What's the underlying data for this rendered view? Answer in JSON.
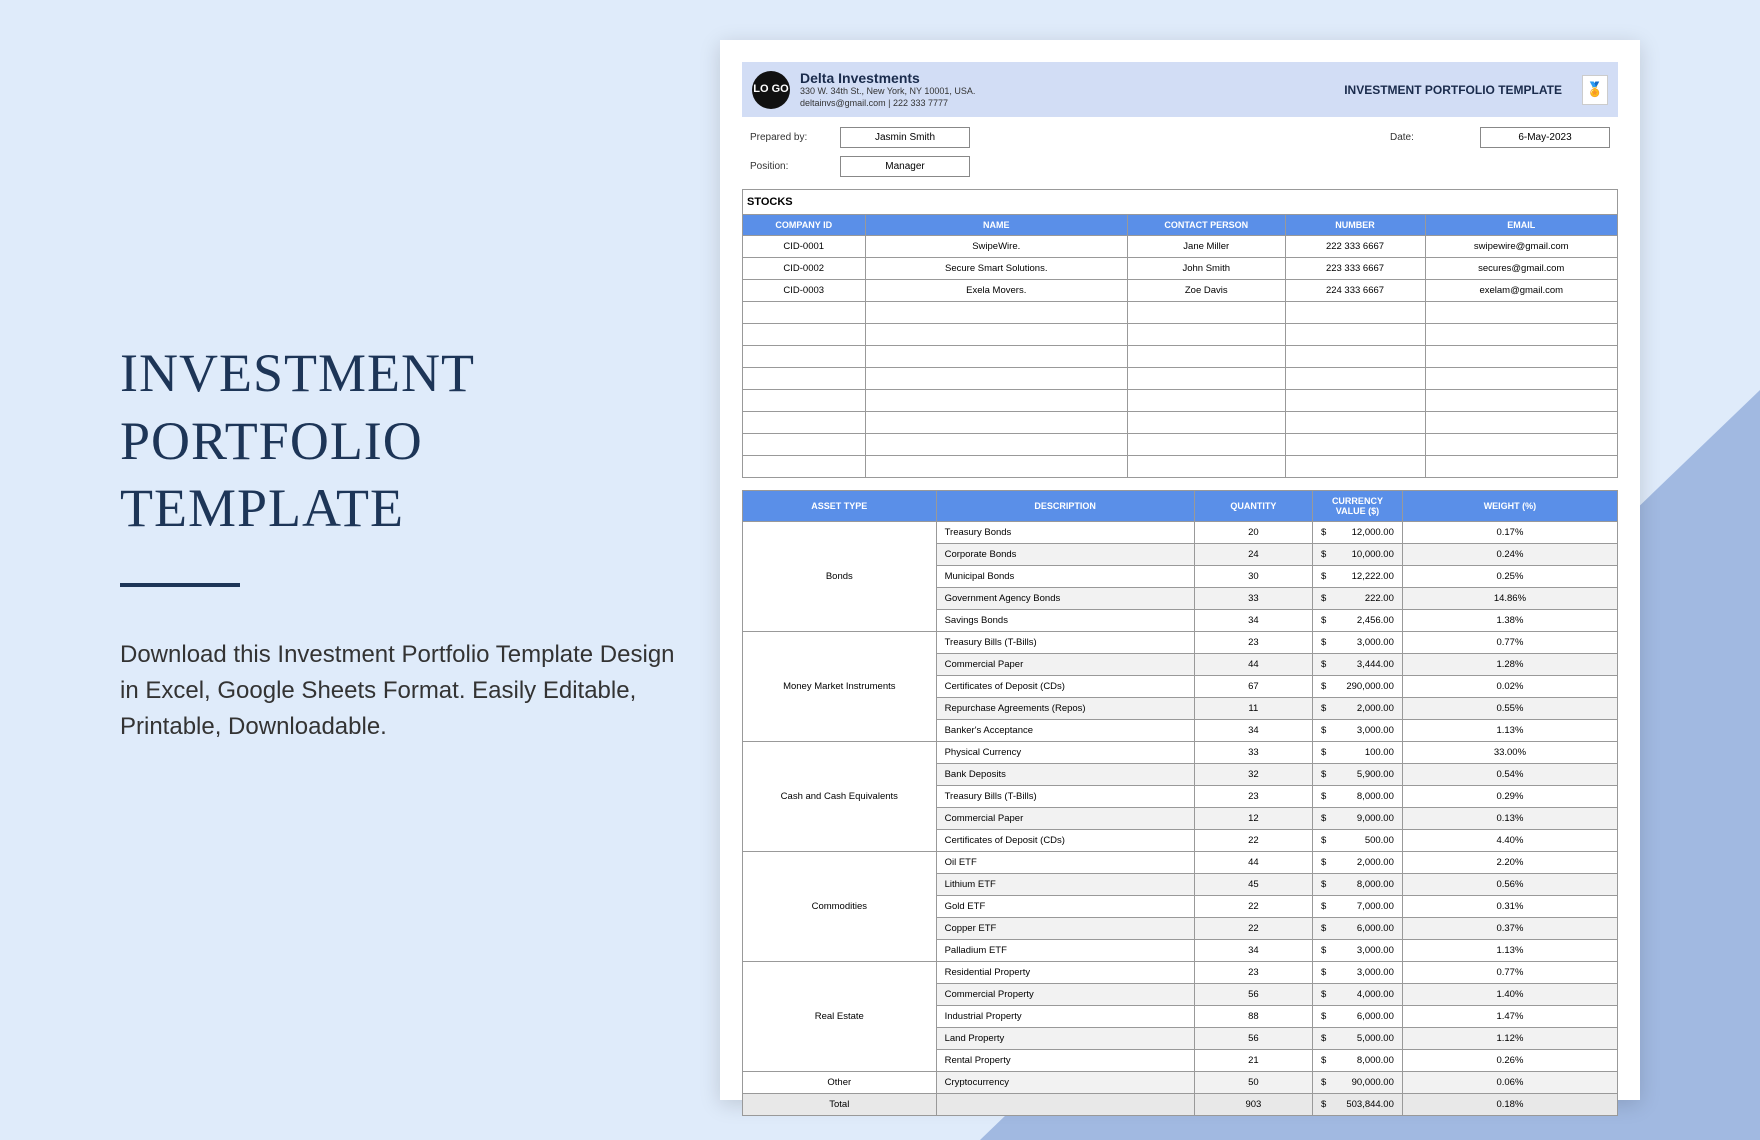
{
  "page": {
    "title_line1": "INVESTMENT",
    "title_line2": "PORTFOLIO TEMPLATE",
    "description": "Download this Investment Portfolio Template Design in Excel, Google Sheets Format. Easily Editable, Printable, Downloadable."
  },
  "doc": {
    "logo_text": "LO\nGO",
    "company_name": "Delta Investments",
    "company_addr1": "330 W. 34th St., New York, NY 10001, USA.",
    "company_addr2": "deltainvs@gmail.com | 222 333 7777",
    "title": "INVESTMENT PORTFOLIO TEMPLATE",
    "badge": "🏅",
    "meta": {
      "prepared_by_label": "Prepared by:",
      "prepared_by_value": "Jasmin Smith",
      "date_label": "Date:",
      "date_value": "6-May-2023",
      "position_label": "Position:",
      "position_value": "Manager"
    },
    "stocks": {
      "section": "STOCKS",
      "headers": [
        "COMPANY ID",
        "NAME",
        "CONTACT PERSON",
        "NUMBER",
        "EMAIL"
      ],
      "rows": [
        [
          "CID-0001",
          "SwipeWire.",
          "Jane Miller",
          "222 333 6667",
          "swipewire@gmail.com"
        ],
        [
          "CID-0002",
          "Secure Smart Solutions.",
          "John Smith",
          "223 333 6667",
          "secures@gmail.com"
        ],
        [
          "CID-0003",
          "Exela Movers.",
          "Zoe Davis",
          "224 333 6667",
          "exelam@gmail.com"
        ]
      ],
      "empty_rows": 8
    },
    "assets": {
      "headers": [
        "ASSET TYPE",
        "DESCRIPTION",
        "QUANTITY",
        "CURRENCY VALUE ($)",
        "WEIGHT (%)"
      ],
      "groups": [
        {
          "type": "Bonds",
          "rows": [
            {
              "desc": "Treasury Bonds",
              "qty": "20",
              "val": "12,000.00",
              "w": "0.17%",
              "shade": false
            },
            {
              "desc": "Corporate Bonds",
              "qty": "24",
              "val": "10,000.00",
              "w": "0.24%",
              "shade": true
            },
            {
              "desc": "Municipal Bonds",
              "qty": "30",
              "val": "12,222.00",
              "w": "0.25%",
              "shade": false
            },
            {
              "desc": "Government Agency Bonds",
              "qty": "33",
              "val": "222.00",
              "w": "14.86%",
              "shade": true
            },
            {
              "desc": "Savings Bonds",
              "qty": "34",
              "val": "2,456.00",
              "w": "1.38%",
              "shade": false
            }
          ]
        },
        {
          "type": "Money Market Instruments",
          "rows": [
            {
              "desc": "Treasury Bills (T-Bills)",
              "qty": "23",
              "val": "3,000.00",
              "w": "0.77%",
              "shade": false
            },
            {
              "desc": "Commercial Paper",
              "qty": "44",
              "val": "3,444.00",
              "w": "1.28%",
              "shade": true
            },
            {
              "desc": "Certificates of Deposit (CDs)",
              "qty": "67",
              "val": "290,000.00",
              "w": "0.02%",
              "shade": false
            },
            {
              "desc": "Repurchase Agreements (Repos)",
              "qty": "11",
              "val": "2,000.00",
              "w": "0.55%",
              "shade": true
            },
            {
              "desc": "Banker's Acceptance",
              "qty": "34",
              "val": "3,000.00",
              "w": "1.13%",
              "shade": false
            }
          ]
        },
        {
          "type": "Cash and Cash Equivalents",
          "rows": [
            {
              "desc": "Physical Currency",
              "qty": "33",
              "val": "100.00",
              "w": "33.00%",
              "shade": false
            },
            {
              "desc": "Bank Deposits",
              "qty": "32",
              "val": "5,900.00",
              "w": "0.54%",
              "shade": true
            },
            {
              "desc": "Treasury Bills (T-Bills)",
              "qty": "23",
              "val": "8,000.00",
              "w": "0.29%",
              "shade": false
            },
            {
              "desc": "Commercial Paper",
              "qty": "12",
              "val": "9,000.00",
              "w": "0.13%",
              "shade": true
            },
            {
              "desc": "Certificates of Deposit (CDs)",
              "qty": "22",
              "val": "500.00",
              "w": "4.40%",
              "shade": false
            }
          ]
        },
        {
          "type": "Commodities",
          "rows": [
            {
              "desc": "Oil ETF",
              "qty": "44",
              "val": "2,000.00",
              "w": "2.20%",
              "shade": false
            },
            {
              "desc": "Lithium ETF",
              "qty": "45",
              "val": "8,000.00",
              "w": "0.56%",
              "shade": true
            },
            {
              "desc": "Gold ETF",
              "qty": "22",
              "val": "7,000.00",
              "w": "0.31%",
              "shade": false
            },
            {
              "desc": "Copper ETF",
              "qty": "22",
              "val": "6,000.00",
              "w": "0.37%",
              "shade": true
            },
            {
              "desc": "Palladium ETF",
              "qty": "34",
              "val": "3,000.00",
              "w": "1.13%",
              "shade": false
            }
          ]
        },
        {
          "type": "Real Estate",
          "rows": [
            {
              "desc": "Residential Property",
              "qty": "23",
              "val": "3,000.00",
              "w": "0.77%",
              "shade": false
            },
            {
              "desc": "Commercial Property",
              "qty": "56",
              "val": "4,000.00",
              "w": "1.40%",
              "shade": true
            },
            {
              "desc": "Industrial Property",
              "qty": "88",
              "val": "6,000.00",
              "w": "1.47%",
              "shade": false
            },
            {
              "desc": "Land Property",
              "qty": "56",
              "val": "5,000.00",
              "w": "1.12%",
              "shade": true
            },
            {
              "desc": "Rental Property",
              "qty": "21",
              "val": "8,000.00",
              "w": "0.26%",
              "shade": false
            }
          ]
        },
        {
          "type": "Other",
          "rows": [
            {
              "desc": "Cryptocurrency",
              "qty": "50",
              "val": "90,000.00",
              "w": "0.06%",
              "shade": true
            }
          ]
        }
      ],
      "total": {
        "label": "Total",
        "qty": "903",
        "val": "503,844.00",
        "w": "0.18%"
      }
    }
  }
}
